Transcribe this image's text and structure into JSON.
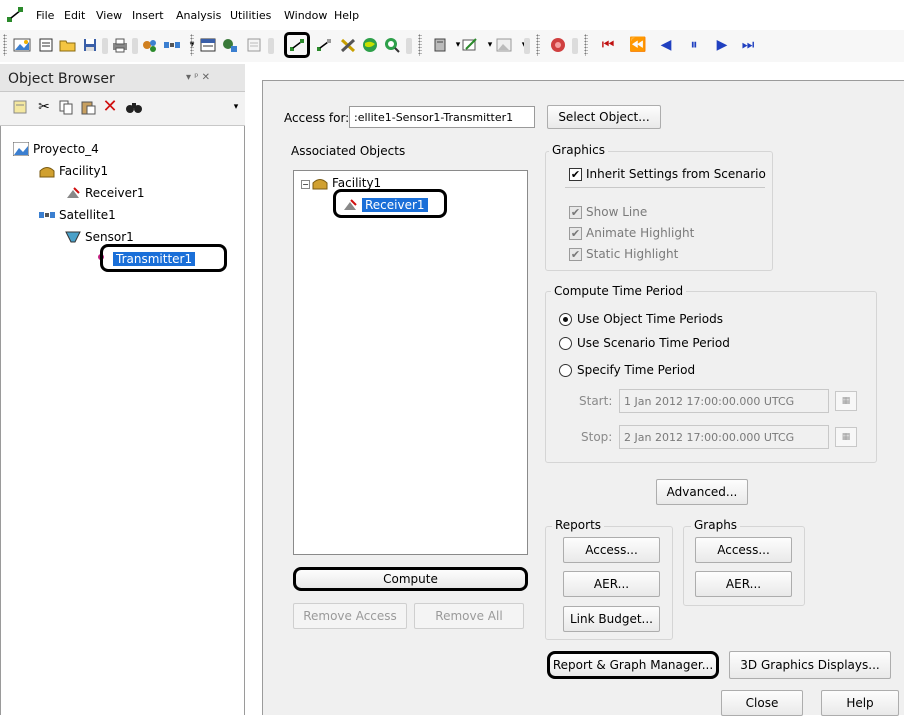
{
  "menu": {
    "items": [
      {
        "label": "File",
        "underline": "F"
      },
      {
        "label": "Edit",
        "underline": "E"
      },
      {
        "label": "View",
        "underline": "V"
      },
      {
        "label": "Insert",
        "underline": "I"
      },
      {
        "label": "Analysis",
        "underline": "A"
      },
      {
        "label": "Utilities",
        "underline": "U"
      },
      {
        "label": "Window",
        "underline": "W"
      },
      {
        "label": "Help",
        "underline": "H"
      }
    ]
  },
  "object_browser": {
    "title": "Object Browser",
    "pin": "▾ ᵖ ✕",
    "tree": {
      "root": "Proyecto_4",
      "facility": "Facility1",
      "receiver": "Receiver1",
      "satellite": "Satellite1",
      "sensor": "Sensor1",
      "transmitter": "Transmitter1"
    }
  },
  "dialog": {
    "access_for_label": "Access for:",
    "access_for_value": ":ellite1-Sensor1-Transmitter1",
    "select_object_label": "Select Object...",
    "associated_objects_label": "Associated Objects",
    "assoc_tree": {
      "facility": "Facility1",
      "receiver": "Receiver1"
    },
    "compute_label": "Compute",
    "remove_access_label": "Remove Access",
    "remove_all_label": "Remove All",
    "graphics": {
      "label": "Graphics",
      "inherit": "Inherit Settings from Scenario",
      "show_line": "Show Line",
      "animate_highlight": "Animate Highlight",
      "static_highlight": "Static Highlight"
    },
    "compute_time": {
      "label": "Compute Time Period",
      "use_object": "Use Object Time Periods",
      "use_scenario": "Use Scenario Time Period",
      "specify": "Specify Time Period",
      "start_label": "Start:",
      "start_value": "1 Jan 2012 17:00:00.000 UTCG",
      "stop_label": "Stop:",
      "stop_value": "2 Jan 2012 17:00:00.000 UTCG"
    },
    "advanced_label": "Advanced...",
    "reports": {
      "label": "Reports",
      "access": "Access...",
      "aer": "AER...",
      "link_budget": "Link Budget..."
    },
    "graphs": {
      "label": "Graphs",
      "access": "Access...",
      "aer": "AER..."
    },
    "report_graph_manager_label": "Report & Graph Manager...",
    "graphics_3d_label": "3D Graphics Displays...",
    "close_label": "Close",
    "help_label": "Help"
  },
  "colors": {
    "selection": "#1a6fd8",
    "dialog_bg": "#f0f0f0"
  }
}
